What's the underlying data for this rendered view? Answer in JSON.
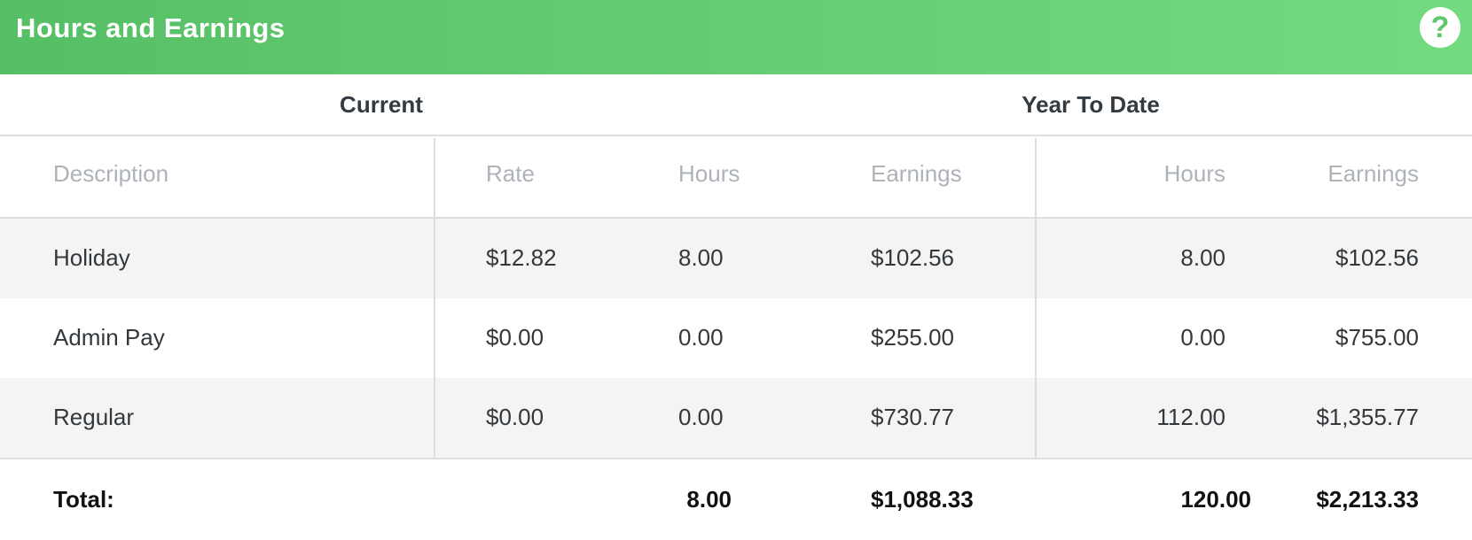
{
  "header": {
    "title": "Hours and Earnings",
    "help_icon": "help-circle-icon"
  },
  "groups": {
    "current": "Current",
    "ytd": "Year To Date"
  },
  "columns": {
    "description": "Description",
    "rate": "Rate",
    "hours": "Hours",
    "earnings": "Earnings",
    "ytd_hours": "Hours",
    "ytd_earnings": "Earnings"
  },
  "rows": [
    {
      "description": "Holiday",
      "rate": "$12.82",
      "hours": "8.00",
      "earnings": "$102.56",
      "ytd_hours": "8.00",
      "ytd_earnings": "$102.56"
    },
    {
      "description": "Admin Pay",
      "rate": "$0.00",
      "hours": "0.00",
      "earnings": "$255.00",
      "ytd_hours": "0.00",
      "ytd_earnings": "$755.00"
    },
    {
      "description": "Regular",
      "rate": "$0.00",
      "hours": "0.00",
      "earnings": "$730.77",
      "ytd_hours": "112.00",
      "ytd_earnings": "$1,355.77"
    }
  ],
  "total": {
    "label": "Total:",
    "hours": "8.00",
    "earnings": "$1,088.33",
    "ytd_hours": "120.00",
    "ytd_earnings": "$2,213.33"
  },
  "colors": {
    "header_start": "#56bf66",
    "header_end": "#74da80",
    "row_shade": "#f4f4f4"
  }
}
